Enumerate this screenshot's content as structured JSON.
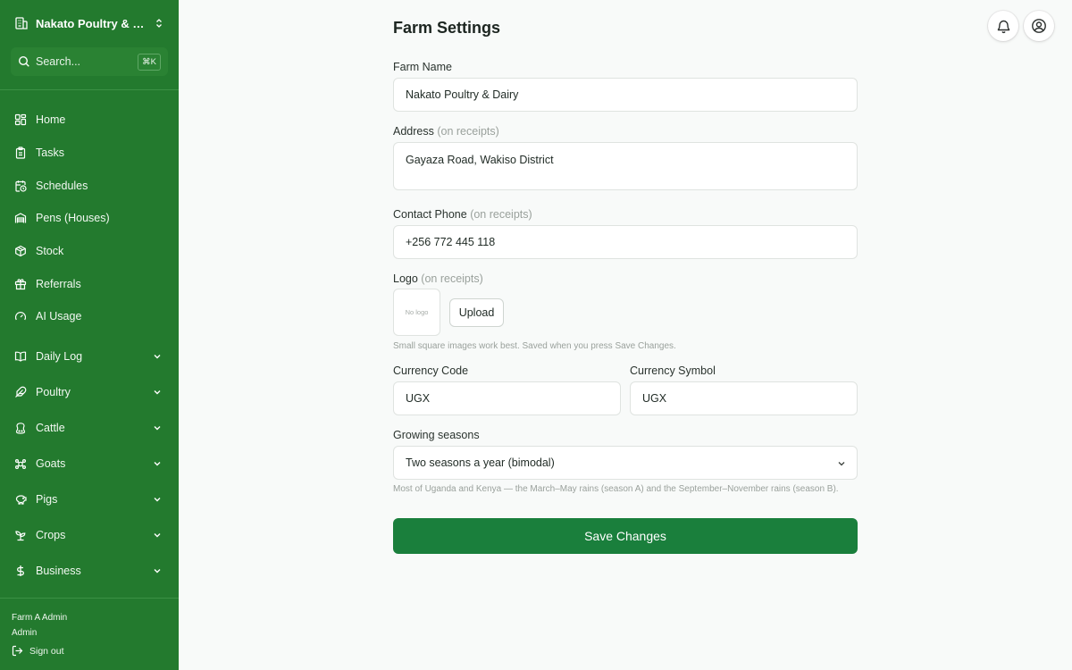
{
  "sidebar": {
    "farm_name": "Nakato Poultry & Da...",
    "search": {
      "placeholder": "Search...",
      "shortcut": "⌘K"
    },
    "items": [
      {
        "label": "Home",
        "icon": "grid-icon"
      },
      {
        "label": "Tasks",
        "icon": "clipboard-icon"
      },
      {
        "label": "Schedules",
        "icon": "calendar-clock-icon"
      },
      {
        "label": "Pens (Houses)",
        "icon": "warehouse-icon"
      },
      {
        "label": "Stock",
        "icon": "package-icon"
      },
      {
        "label": "Referrals",
        "icon": "gift-icon"
      },
      {
        "label": "AI Usage",
        "icon": "gauge-icon"
      }
    ],
    "groups": [
      {
        "label": "Daily Log",
        "icon": "book-open-icon"
      },
      {
        "label": "Poultry",
        "icon": "feather-icon"
      },
      {
        "label": "Cattle",
        "icon": "cattle-icon"
      },
      {
        "label": "Goats",
        "icon": "goat-icon"
      },
      {
        "label": "Pigs",
        "icon": "piggy-icon"
      },
      {
        "label": "Crops",
        "icon": "sprout-icon"
      },
      {
        "label": "Business",
        "icon": "dollar-icon"
      }
    ],
    "user": {
      "name": "Farm A Admin",
      "role": "Admin"
    },
    "sign_out": "Sign out"
  },
  "header": {
    "title": "Farm Settings",
    "notifications_icon": "bell-icon",
    "account_icon": "user-circle-icon"
  },
  "form": {
    "farm_name": {
      "label": "Farm Name",
      "value": "Nakato Poultry & Dairy"
    },
    "address": {
      "label": "Address",
      "hint": "(on receipts)",
      "value": "Gayaza Road, Wakiso District"
    },
    "phone": {
      "label": "Contact Phone",
      "hint": "(on receipts)",
      "value": "+256 772 445 118"
    },
    "logo": {
      "label": "Logo",
      "hint": "(on receipts)",
      "placeholder": "No logo",
      "upload_label": "Upload",
      "help": "Small square images work best. Saved when you press Save Changes."
    },
    "currency_code": {
      "label": "Currency Code",
      "value": "UGX"
    },
    "currency_symbol": {
      "label": "Currency Symbol",
      "value": "UGX"
    },
    "seasons": {
      "label": "Growing seasons",
      "value": "Two seasons a year (bimodal)",
      "help": "Most of Uganda and Kenya — the March–May rains (season A) and the September–November rains (season B)."
    },
    "save_label": "Save Changes"
  },
  "colors": {
    "sidebar": "#237a2e",
    "primary_button": "#1a7f3c",
    "background": "#f8faf9"
  }
}
